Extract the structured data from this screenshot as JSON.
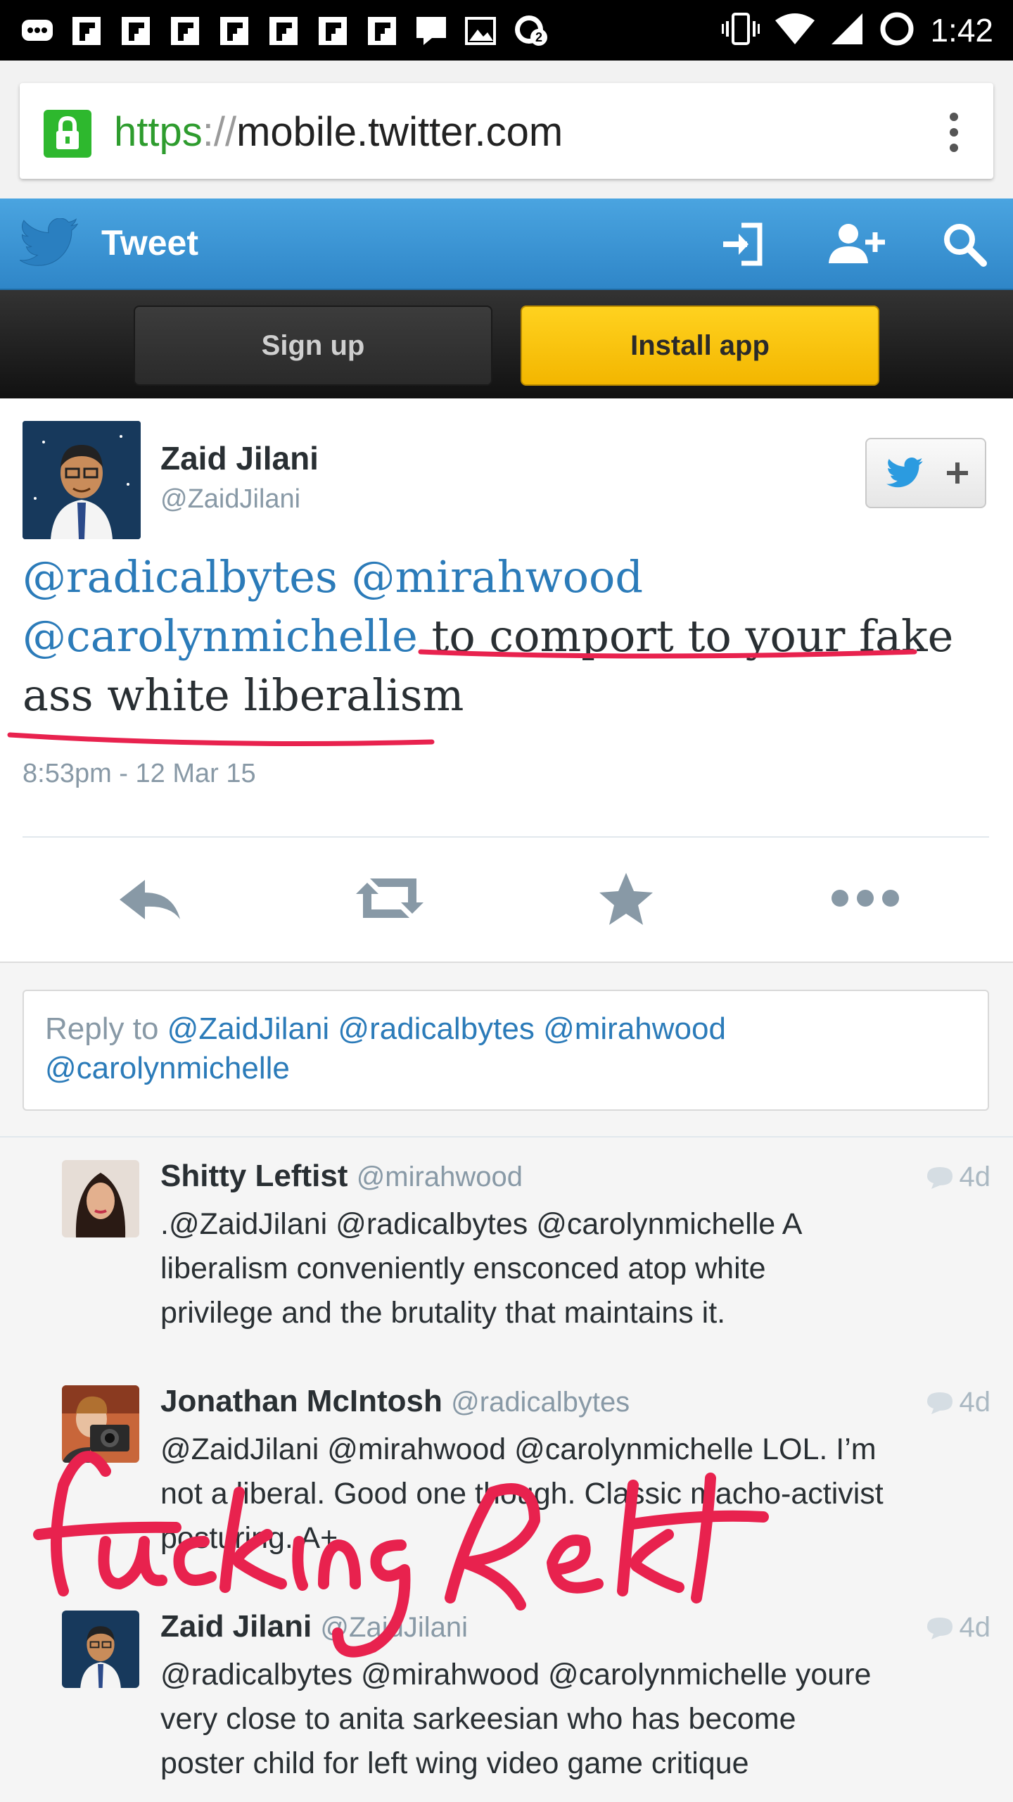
{
  "status_bar": {
    "time": "1:42",
    "notification_icons": [
      "chat-bubble-dots-icon",
      "flipboard-icon",
      "flipboard-icon",
      "flipboard-icon",
      "flipboard-icon",
      "flipboard-icon",
      "flipboard-icon",
      "flipboard-icon",
      "message-icon",
      "image-icon",
      "whatsapp-icon"
    ],
    "badge_count": "2",
    "right_icons": [
      "vibrate-icon",
      "wifi-icon",
      "cell-signal-icon",
      "sync-icon"
    ]
  },
  "browser": {
    "url_scheme": "https",
    "url_separator": "://",
    "url_host": "mobile.twitter.com",
    "secure": true
  },
  "twitter_header": {
    "title": "Tweet",
    "icons": [
      "bird-logo-icon",
      "sign-in-icon",
      "add-user-icon",
      "search-icon"
    ]
  },
  "signup_bar": {
    "signup_label": "Sign up",
    "install_label": "Install app"
  },
  "tweet": {
    "author_name": "Zaid Jilani",
    "author_handle": "@ZaidJilani",
    "mention_1": "@radicalbytes",
    "mention_2": "@mirahwood",
    "mention_3": "@carolynmichelle",
    "text_line_2_rest": "to comport to your fake",
    "text_line_3": "ass white liberalism",
    "timestamp": "8:53pm - 12 Mar 15",
    "actions": [
      "reply-icon",
      "retweet-icon",
      "favorite-icon",
      "more-icon"
    ],
    "underline_color": "#e8224e"
  },
  "reply_box": {
    "prefix": "Reply to",
    "mentions_line1": "@ZaidJilani @radicalbytes @mirahwood",
    "mentions_line2": "@carolynmichelle"
  },
  "replies": [
    {
      "name": "Shitty Leftist",
      "handle": "@mirahwood",
      "age": "4d",
      "line1": ".@ZaidJilani @radicalbytes @carolynmichelle A",
      "line2": "liberalism conveniently ensconced atop white",
      "line3": "privilege and the brutality that maintains it."
    },
    {
      "name": "Jonathan McIntosh",
      "handle": "@radicalbytes",
      "age": "4d",
      "line1": "@ZaidJilani @mirahwood @carolynmichelle LOL. I’m",
      "line2": "not a liberal. Good one though. Classic macho-activist",
      "line3": "posturing. A+"
    },
    {
      "name": "Zaid Jilani",
      "handle": "@ZaidJilani",
      "age": "4d",
      "line1": "@radicalbytes @mirahwood @carolynmichelle youre",
      "line2": "very close to anita sarkeesian who has become",
      "line3": "poster child for left wing video game critique"
    }
  ],
  "annotation": {
    "handwritten_text": "fucking Rekt",
    "color": "#e8224e"
  }
}
